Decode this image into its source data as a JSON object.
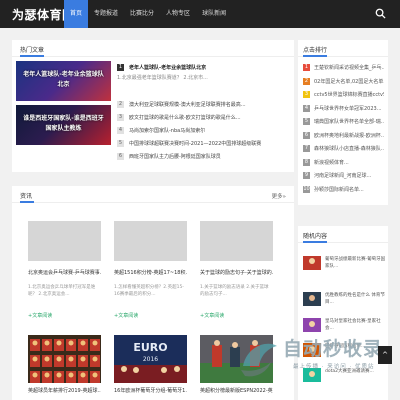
{
  "site": {
    "logo": "为瑟体育网"
  },
  "nav": [
    "首页",
    "专题报道",
    "比赛比分",
    "人物专区",
    "球队新闻"
  ],
  "hot": {
    "title": "热门文章",
    "slides": [
      {
        "text": "老年人篮球队-老年业余篮球队北京"
      },
      {
        "text": "谁是西班牙国家队-谁是西班牙国家队主教练"
      }
    ],
    "top": {
      "text": "老年人篮球队-老年业余篮球队北京",
      "sub": "1.北京最强老年篮球队赛道？ 2.北京市..."
    },
    "list": [
      "澳大利亚足球联赛规模-澳大利亚足球联赛排名最高...",
      "欧文打篮球的歌是什么歌-欧文打篮球的歌是什么...",
      "马尚加索尔国家队-nba马尚加索尔",
      "中国排球球超联赛决赛时间-2021—2022中国排球超级联赛",
      "西班牙国家队主力后腰-阿根廷国家队球员"
    ]
  },
  "recommend": {
    "title": "点击排行",
    "items": [
      "王楚钦新闻采访视频全集_乒乓...",
      "02年国足大名单,02国足大名单...",
      "cctv5世界篮球锦标赛直播cctv5...",
      "乒乓球世界杯女单冠军2023...",
      "瑞典国家队世界杯名单全部-瑞...",
      "欧洲杯奥地利最新战报-欧洲杯...",
      "森林狼球队小店直播-森林狼队...",
      "新浪视频体育...",
      "河南足球新闻_河南足球...",
      "孙颖莎国际新闻名单..."
    ],
    "colors": [
      "#e74c3c",
      "#e67e22",
      "#f1c40f",
      "#999999",
      "#999999",
      "#999999",
      "#999999",
      "#999999",
      "#999999",
      "#999999"
    ]
  },
  "news": {
    "title": "资讯",
    "more": "更多»",
    "items": [
      {
        "title": "北京奥运会乒乓球赛-乒乓球赛事...",
        "desc": "1.北京奥运会乒乓球单打冠军是谁呢？ 2.北京奥运会...",
        "more": "+文章阅读"
      },
      {
        "title": "英超1516积分榜-英超17~18积...",
        "desc": "1.怎样看懂英超积分榜？2.英超15-16赛季最后的积分...",
        "more": "+文章阅读"
      },
      {
        "title": "关于篮球的励志句子-关于篮球的...",
        "desc": "1.关于篮球的励志语录 2.关于篮球的励志句子...",
        "more": "+文章阅读"
      }
    ],
    "bottom": [
      {
        "title": "英超球员年薪排行2019-英超球..."
      },
      {
        "title": "16年欧洲杯葡萄牙分组-葡萄牙1..."
      },
      {
        "title": "英超积分榜最新版ESPN2022-英..."
      }
    ]
  },
  "random": {
    "title": "随机内容",
    "items": [
      "葡萄牙战绩最新比赛-葡萄牙国家队...",
      "优胜教练的姓名是什么 体育节目...",
      "皇马对皇家社会比赛-皇家社会...",
      "巴萨夺冠历程名单...",
      "dota2大赛亚洲邀请赛..."
    ]
  },
  "watermark": {
    "text": "自动秒收录",
    "sub": "最上传播 · 来访问 · 优质站"
  },
  "backtop": "^"
}
